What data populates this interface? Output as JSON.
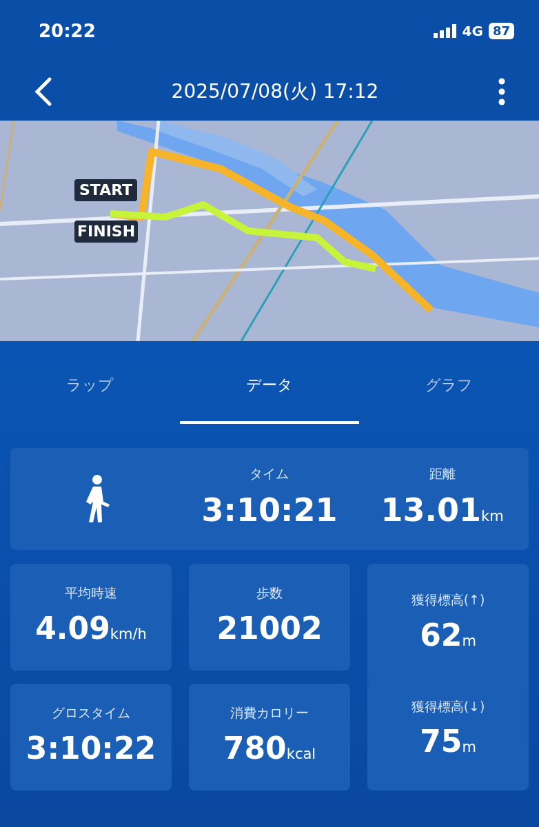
{
  "status_bar": {
    "time": "20:22",
    "network": "4G",
    "battery": "87"
  },
  "header": {
    "title": "2025/07/08(火) 17:12"
  },
  "map": {
    "start_label": "START",
    "finish_label": "FINISH"
  },
  "tabs": [
    {
      "label": "ラップ",
      "selected": false
    },
    {
      "label": "データ",
      "selected": true
    },
    {
      "label": "グラフ",
      "selected": false
    }
  ],
  "summary": [
    {
      "label": "タイム",
      "value": "3:10:21"
    },
    {
      "label": "距離",
      "value": "13.01",
      "unit": "km"
    }
  ],
  "stats": [
    {
      "label": "平均時速",
      "value": "4.09",
      "unit": "km/h"
    },
    {
      "label": "歩数",
      "value": "21002"
    },
    {
      "label": "グロスタイム",
      "value": "3:10:22"
    },
    {
      "label": "消費カロリー",
      "value": "780",
      "unit": "kcal"
    }
  ],
  "elevation": [
    {
      "label": "獲得標高(↑)",
      "value": "62",
      "unit": "m"
    },
    {
      "label": "獲得標高(↓)",
      "value": "75",
      "unit": "m"
    }
  ]
}
